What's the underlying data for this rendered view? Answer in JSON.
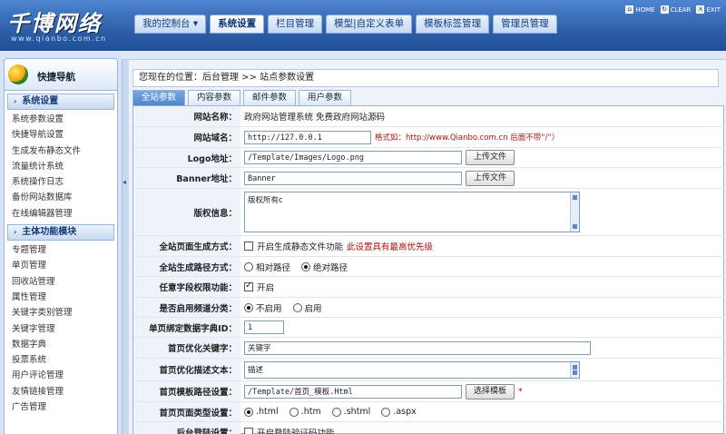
{
  "header": {
    "logo": "千博网络",
    "logo_sub": "www.qianbo.com.cn",
    "nav_tabs": [
      {
        "label": "我的控制台 ▾",
        "active": false
      },
      {
        "label": "系统设置",
        "active": true
      },
      {
        "label": "栏目管理",
        "active": false
      },
      {
        "label": "模型|自定义表单",
        "active": false
      },
      {
        "label": "模板标签管理",
        "active": false
      },
      {
        "label": "管理员管理",
        "active": false
      }
    ],
    "tools": [
      {
        "label": "HOME",
        "icon": "home-icon"
      },
      {
        "label": "CLEAR",
        "icon": "clear-icon"
      },
      {
        "label": "EXIT",
        "icon": "exit-icon"
      }
    ]
  },
  "sidebar": {
    "title": "快捷导航",
    "sections": [
      {
        "title": "系统设置",
        "items": [
          "系统参数设置",
          "快捷导航设置",
          "生成发布静态文件",
          "流量统计系统",
          "系统操作日志",
          "备份网站数据库",
          "在线编辑器管理"
        ]
      },
      {
        "title": "主体功能模块",
        "items": [
          "专题管理",
          "单页管理",
          "回收站管理",
          "属性管理",
          "关键字类别管理",
          "关键字管理",
          "数据字典",
          "投票系统",
          "用户评论管理",
          "友情链接管理",
          "广告管理"
        ]
      }
    ]
  },
  "main": {
    "breadcrumb": "您现在的位置：后台管理 >> 站点参数设置",
    "tabs": [
      {
        "label": "全站参数",
        "active": true
      },
      {
        "label": "内容参数",
        "active": false
      },
      {
        "label": "邮件参数",
        "active": false
      },
      {
        "label": "用户参数",
        "active": false
      }
    ],
    "form": {
      "site_name": {
        "label": "网站名称：",
        "value": "政府网站管理系统 免费政府网站源码"
      },
      "site_domain": {
        "label": "网站域名：",
        "value": "http://127.0.0.1",
        "hint": "格式如：http://www.Qianbo.com.cn 后面不带“/”）"
      },
      "logo": {
        "label": "Logo地址：",
        "value": "/Template/Images/Logo.png",
        "button": "上传文件"
      },
      "banner": {
        "label": "Banner地址：",
        "value": "Banner",
        "button": "上传文件"
      },
      "copyright": {
        "label": "版权信息：",
        "value": "版权所有c"
      },
      "static_gen": {
        "label": "全站页面生成方式：",
        "checkbox_label": "开启生成静态文件功能",
        "checked": false,
        "note": "此设置具有最高优先级"
      },
      "path_mode": {
        "label": "全站生成路径方式：",
        "options": [
          "相对路径",
          "绝对路径"
        ],
        "selected": 1
      },
      "field_perm": {
        "label": "任意字段权限功能：",
        "checkbox_label": "开启",
        "checked": true
      },
      "channel_cat": {
        "label": "是否启用频道分类：",
        "options": [
          "不启用",
          "启用"
        ],
        "selected": 0
      },
      "dict_id": {
        "label": "单页绑定数据字典ID：",
        "value": "1"
      },
      "seo_keywords": {
        "label": "首页优化关键字：",
        "value": "关键字"
      },
      "seo_desc": {
        "label": "首页优化描述文本：",
        "value": "描述"
      },
      "tpl_path": {
        "label": "首页模板路径设置：",
        "value": "/Template/首页_模板.Html",
        "button": "选择模板",
        "required": "*"
      },
      "page_type": {
        "label": "首页页面类型设置：",
        "options": [
          ".html",
          ".htm",
          ".shtml",
          ".aspx"
        ],
        "selected": 0
      },
      "last_row": {
        "label": "后台登陆设置：",
        "text": "开启登陆验证码功能"
      }
    }
  }
}
